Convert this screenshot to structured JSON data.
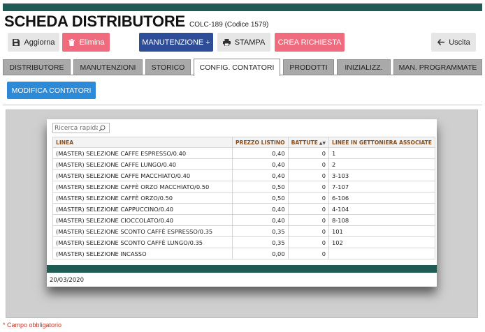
{
  "header": {
    "title": "SCHEDA DISTRIBUTORE",
    "subtitle": "COLC-189 (Codice 1579)"
  },
  "toolbar": {
    "aggiorna": "Aggiorna",
    "elimina": "Elimina",
    "manutenzione": "MANUTENZIONE +",
    "stampa": "STAMPA",
    "crea_richiesta": "CREA RICHIESTA",
    "uscita": "Uscita"
  },
  "tabs": [
    {
      "label": "DISTRIBUTORE"
    },
    {
      "label": "MANUTENZIONI"
    },
    {
      "label": "STORICO"
    },
    {
      "label": "CONFIG. CONTATORI"
    },
    {
      "label": "PRODOTTI"
    },
    {
      "label": "INIZIALIZZ."
    },
    {
      "label": "MAN. PROGRAMMATE"
    }
  ],
  "active_tab": "CONFIG. CONTATORI",
  "modify_button": "MODIFICA CONTATORI",
  "search": {
    "placeholder": "Ricerca rapida"
  },
  "table": {
    "headers": [
      "LINEA",
      "PREZZO LISTINO",
      "BATTUTE",
      "LINEE IN GETTONIERA ASSOCIATE"
    ],
    "rows": [
      [
        "(MASTER) SELEZIONE CAFFE ESPRESSO/0.40",
        "0,40",
        "0",
        "1"
      ],
      [
        "(MASTER) SELEZIONE CAFFE LUNGO/0.40",
        "0,40",
        "0",
        "2"
      ],
      [
        "(MASTER) SELEZIONE CAFFE MACCHIATO/0.40",
        "0,40",
        "0",
        "3-103"
      ],
      [
        "(MASTER) SELEZIONE CAFFÈ ORZO MACCHIATO/0.50",
        "0,50",
        "0",
        "7-107"
      ],
      [
        "(MASTER) SELEZIONE CAFFÈ ORZO/0.50",
        "0,50",
        "0",
        "6-106"
      ],
      [
        "(MASTER) SELEZIONE CAPPUCCINO/0.40",
        "0,40",
        "0",
        "4-104"
      ],
      [
        "(MASTER) SELEZIONE CIOCCOLATO/0.40",
        "0,40",
        "0",
        "8-108"
      ],
      [
        "(MASTER) SELEZIONE SCONTO CAFFÈ ESPRESSO/0.35",
        "0,35",
        "0",
        "101"
      ],
      [
        "(MASTER) SELEZIONE SCONTO CAFFÈ LUNGO/0.35",
        "0,35",
        "0",
        "102"
      ],
      [
        "(MASTER) SELEZIONE INCASSO",
        "0,00",
        "0",
        ""
      ]
    ]
  },
  "card_footer_date": "20/03/2020",
  "footnote": "* Campo obbligatorio",
  "colors": {
    "header_bar": "#1f5a54",
    "pink": "#f16b7e",
    "navy": "#2e4d99",
    "blue": "#2d8ad6",
    "tab_gray": "#a9a9a9"
  },
  "icons": {
    "aggiorna": "save-icon",
    "elimina": "trash-icon",
    "stampa": "print-icon",
    "uscita": "arrow-left-icon",
    "search": "search-icon",
    "sort": "sort-icon"
  }
}
